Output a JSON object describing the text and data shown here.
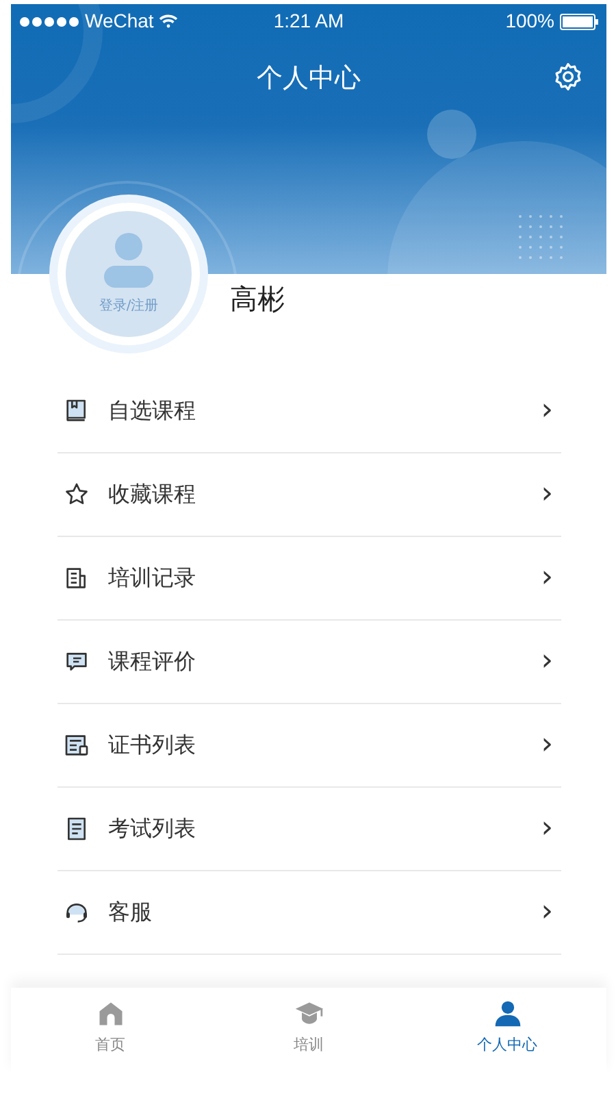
{
  "status_bar": {
    "carrier": "WeChat",
    "time": "1:21 AM",
    "battery": "100%"
  },
  "header": {
    "title": "个人中心"
  },
  "profile": {
    "login_label": "登录/注册",
    "name": "高彬"
  },
  "menu": [
    {
      "label": "自选课程",
      "chevron": "›"
    },
    {
      "label": "收藏课程",
      "chevron": "›"
    },
    {
      "label": "培训记录",
      "chevron": "›"
    },
    {
      "label": "课程评价",
      "chevron": "›"
    },
    {
      "label": "证书列表",
      "chevron": "›"
    },
    {
      "label": "考试列表",
      "chevron": "›"
    },
    {
      "label": "客服",
      "chevron": "›"
    }
  ],
  "tab_bar": [
    {
      "label": "首页",
      "selected": false
    },
    {
      "label": "培训",
      "selected": false
    },
    {
      "label": "个人中心",
      "selected": true
    }
  ]
}
